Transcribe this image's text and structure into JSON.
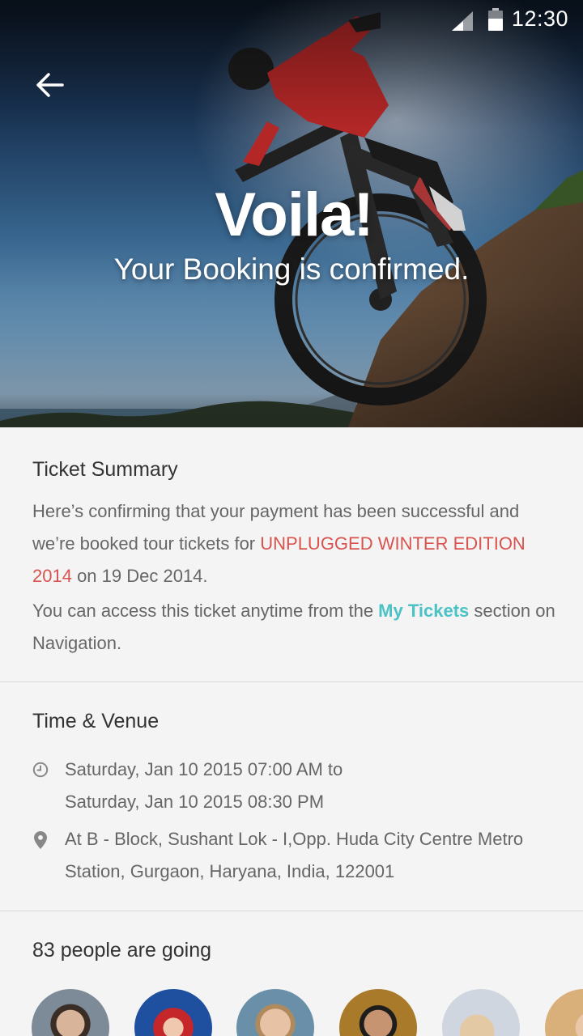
{
  "status_bar": {
    "time": "12:30",
    "icons": [
      "signal-icon",
      "battery-icon"
    ]
  },
  "header": {
    "back_icon": "arrow-left-icon",
    "title": "Voila!",
    "subtitle": "Your Booking is confirmed."
  },
  "ticket_summary": {
    "heading": "Ticket Summary",
    "line1_pre": "Here’s confirming that your payment has been successful and we’re booked tour tickets for ",
    "event_name": "UNPLUGGED WINTER EDITION 2014",
    "line1_post": " on 19 Dec 2014.",
    "line2_pre": "You can access this ticket anytime from the ",
    "my_tickets_link": "My Tickets",
    "line2_post": " section on Navigation."
  },
  "time_venue": {
    "heading": "Time & Venue",
    "time_start": "Saturday, Jan 10 2015 07:00 AM to",
    "time_end": "Saturday, Jan 10 2015 08:30 PM",
    "address": "At B - Block, Sushant Lok - I,Opp. Huda City Centre Metro Station, Gurgaon, Haryana, India, 122001"
  },
  "attendees": {
    "heading": "83 people are going",
    "avatars": [
      "avatar-1",
      "avatar-2",
      "avatar-3",
      "avatar-4",
      "avatar-5",
      "avatar-6"
    ]
  },
  "colors": {
    "accent_red": "#d9534f",
    "accent_teal": "#4bc2c5",
    "background": "#f4f4f4"
  }
}
